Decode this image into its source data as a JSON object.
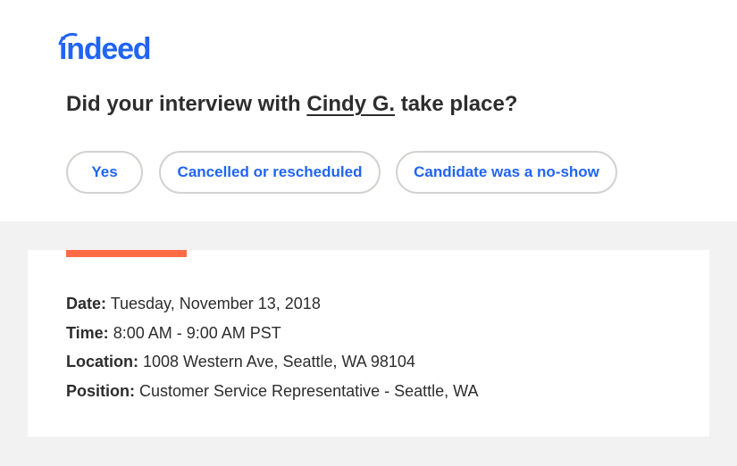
{
  "brand": {
    "logo_text": "indeed",
    "color": "#2164f3"
  },
  "question": {
    "prefix": "Did your interview with ",
    "name": "Cindy G.",
    "suffix": " take place?"
  },
  "buttons": {
    "yes": "Yes",
    "cancelled": "Cancelled or rescheduled",
    "no_show": "Candidate was a no-show"
  },
  "details": {
    "date_label": "Date:",
    "date_value": " Tuesday, November 13, 2018",
    "time_label": "Time:",
    "time_value": " 8:00 AM - 9:00 AM PST",
    "location_label": "Location:",
    "location_value": " 1008 Western Ave, Seattle, WA 98104",
    "position_label": "Position:",
    "position_value": " Customer Service Representative - Seattle, WA"
  },
  "colors": {
    "accent": "#ff6b45",
    "background": "#f2f2f2",
    "text": "#2d2d2d",
    "button_border": "#d4d2d0"
  }
}
